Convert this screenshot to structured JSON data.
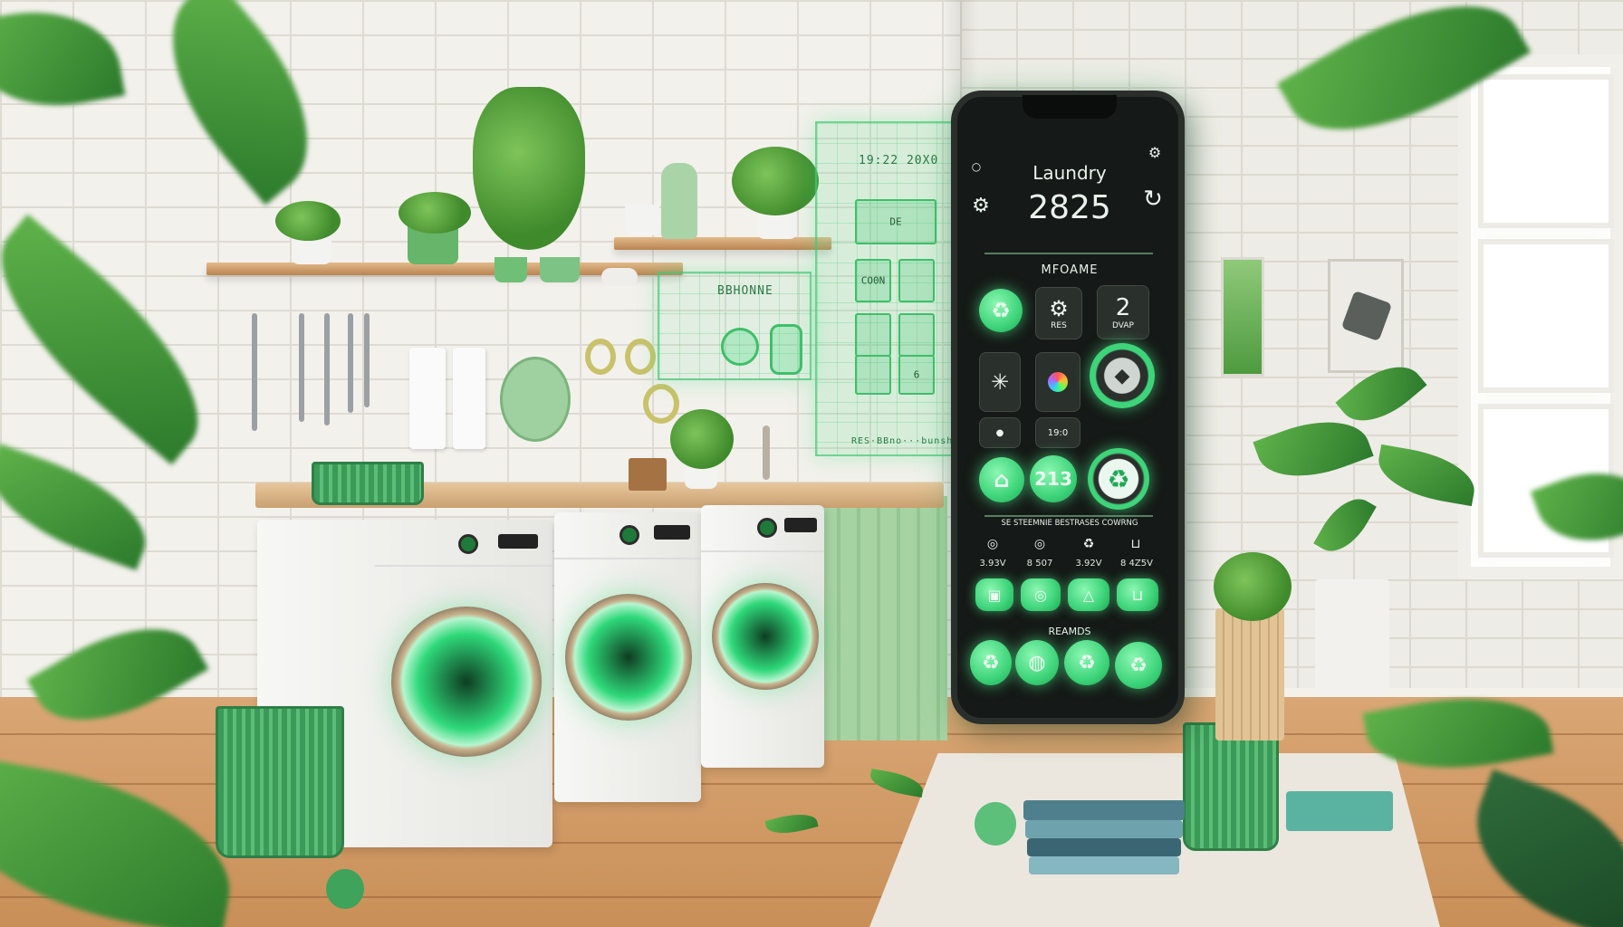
{
  "scene": {
    "description_colors": {
      "accent_green": "#3ed47a",
      "phone_bg": "#151917",
      "holo_green": "#3fbf6b",
      "wood": "#d9a674"
    }
  },
  "hologram": {
    "time_text": "19:22 20X0",
    "label_de": "DE",
    "label_phone": "BBHONNE",
    "tile_labels": [
      "CO0N",
      "",
      "",
      "",
      "",
      "6"
    ],
    "footer_text": "RES·BBno···bunshe"
  },
  "phone": {
    "title": "Laundry",
    "number": "2825",
    "section1": "MFOAME",
    "tile_two": "2",
    "tile_two_sub": "DVAP",
    "tile_res": "RES",
    "pill_number": "213",
    "badge_small": "19:0",
    "section2": "SE STEEMNIE BESTRASES COWRNG",
    "stats": [
      "3.93V",
      "8 507",
      "3.92V",
      "8 4Z5V"
    ],
    "section3": "REAMDS",
    "icons": {
      "recycle": "recycle-icon",
      "gear": "gear-icon",
      "home": "home-icon",
      "diamond": "diamond-icon",
      "washer": "washer-icon",
      "basket": "basket-icon",
      "globe": "globe-icon",
      "alert": "alert-icon"
    }
  }
}
